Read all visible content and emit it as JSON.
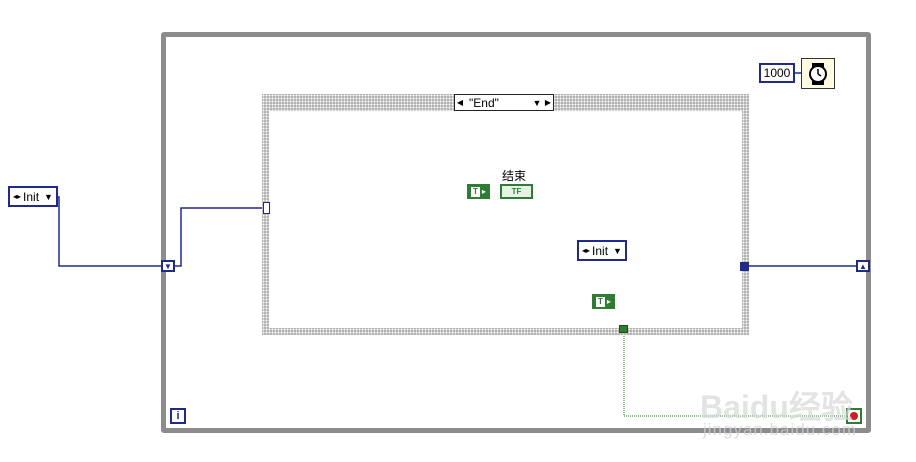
{
  "case_structure": {
    "selector_value": "\"End\""
  },
  "enum_outer": {
    "value": "Init"
  },
  "enum_inner": {
    "value": "Init"
  },
  "wait": {
    "ms_value": "1000"
  },
  "boolean_label": "结束",
  "bool_constant_text": "T",
  "bool_indicator_text": "TF",
  "iteration_text": "i",
  "watermark": {
    "brand": "Baidu经验",
    "url": "jingyan.baidu.com"
  },
  "colors": {
    "enum_wire": "#1f2a8a",
    "bool_wire": "#2e7d32",
    "loop_border": "#8c8c8c"
  }
}
